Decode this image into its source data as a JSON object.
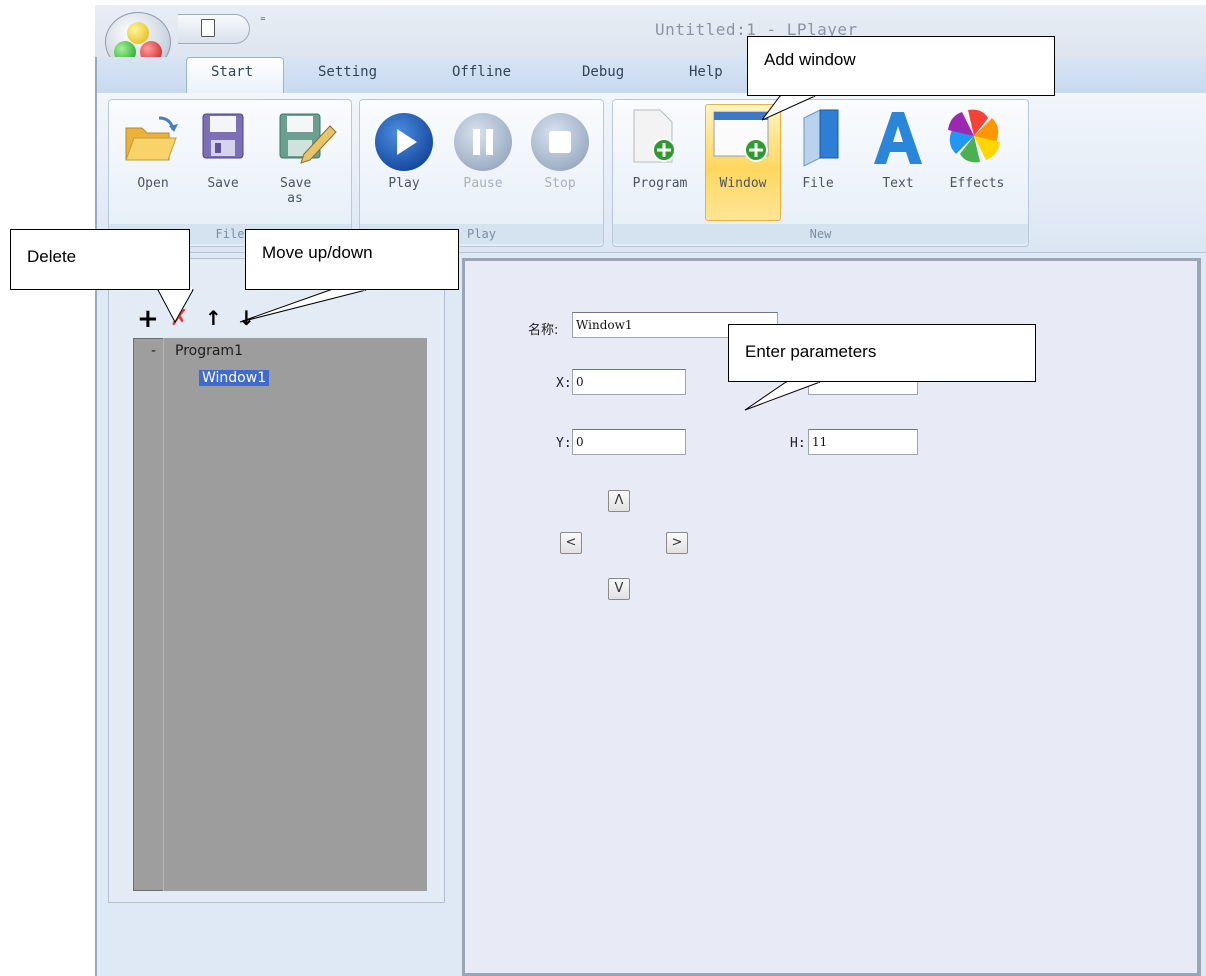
{
  "window": {
    "title": "Untitled:1 - LPlayer"
  },
  "quick_access": {
    "new_icon": "document-icon",
    "dropdown_glyph": "⁼"
  },
  "tabs": [
    {
      "label": "Start",
      "active": true
    },
    {
      "label": "Setting",
      "active": false
    },
    {
      "label": "Offline",
      "active": false
    },
    {
      "label": "Debug",
      "active": false
    },
    {
      "label": "Help",
      "active": false
    }
  ],
  "ribbon": {
    "groups": [
      {
        "label": "File"
      },
      {
        "label": "Play"
      },
      {
        "label": "New"
      }
    ],
    "file": {
      "open": "Open",
      "save": "Save",
      "save_as_line1": "Save",
      "save_as_line2": "as"
    },
    "play": {
      "play": "Play",
      "pause": "Pause",
      "stop": "Stop"
    },
    "new": {
      "program": "Program",
      "window": "Window",
      "file": "File",
      "text": "Text",
      "effects": "Effects"
    }
  },
  "left_panel": {
    "toolbar": {
      "add": "+",
      "delete": "✗",
      "up": "↑",
      "down": "↓"
    },
    "tree": {
      "program": {
        "toggle": "-",
        "label": "Program1"
      },
      "window": {
        "label": "Window1",
        "selected": true
      }
    }
  },
  "form": {
    "name_label": "名称:",
    "name_value": "Window1",
    "x_label": "X:",
    "x_value": "0",
    "y_label": "Y:",
    "y_value": "0",
    "h_label": "H:",
    "h_value": "11",
    "nav": {
      "up": "Λ",
      "left": "<",
      "right": ">",
      "down": "V"
    }
  },
  "callouts": {
    "add_window": "Add window",
    "delete": "Delete",
    "move": "Move up/down",
    "enter_params": "Enter parameters"
  },
  "colors": {
    "accent": "#3d6bd1",
    "tab_bar": "#c8daef",
    "selected_button": "#ffd75f"
  }
}
